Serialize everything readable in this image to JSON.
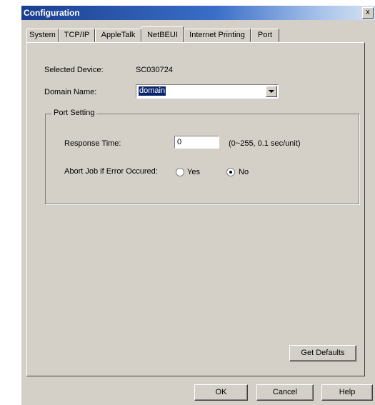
{
  "window": {
    "title": "Configuration",
    "close_glyph": "x"
  },
  "tabs": [
    {
      "label": "System"
    },
    {
      "label": "TCP/IP"
    },
    {
      "label": "AppleTalk"
    },
    {
      "label": "NetBEUI",
      "active": true
    },
    {
      "label": "Internet Printing"
    },
    {
      "label": "Port"
    }
  ],
  "panel": {
    "selected_device_label": "Selected Device:",
    "selected_device_value": "SC030724",
    "domain_name_label": "Domain Name:",
    "domain_name_value": "domain",
    "port_setting": {
      "title": "Port Setting",
      "response_time_label": "Response Time:",
      "response_time_value": "0",
      "response_time_hint": "(0~255, 0.1 sec/unit)",
      "abort_label": "Abort Job if Error Occured:",
      "options": [
        {
          "label": "Yes",
          "checked": false
        },
        {
          "label": "No",
          "checked": true
        }
      ]
    },
    "get_defaults_label": "Get Defaults"
  },
  "footer": {
    "ok_label": "OK",
    "cancel_label": "Cancel",
    "help_label": "Help"
  }
}
